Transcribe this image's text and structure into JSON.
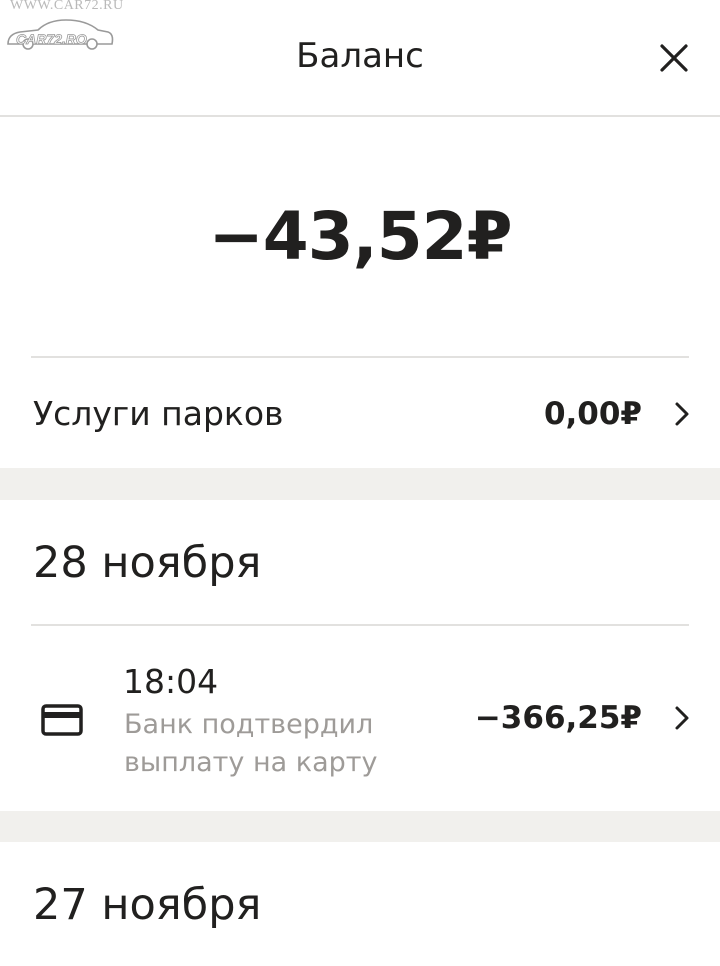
{
  "watermark": {
    "site_url": "WWW.CAR72.RU",
    "logo_text": "CAR72.RO"
  },
  "header": {
    "title": "Баланс",
    "close_icon": "close-icon"
  },
  "balance": {
    "amount": "−43,52₽"
  },
  "services": {
    "label": "Услуги парков",
    "amount": "0,00₽",
    "chevron_icon": "chevron-right-icon"
  },
  "groups": [
    {
      "date": "28 ноября",
      "transactions": [
        {
          "icon": "credit-card-icon",
          "time": "18:04",
          "description": "Банк подтвердил выплату на карту",
          "amount": "−366,25₽"
        }
      ]
    },
    {
      "date": "27 ноября"
    }
  ],
  "colors": {
    "text_primary": "#21201f",
    "text_secondary": "#9e9b98",
    "divider": "#e2e1df",
    "section_gap": "#f1f0ed"
  }
}
